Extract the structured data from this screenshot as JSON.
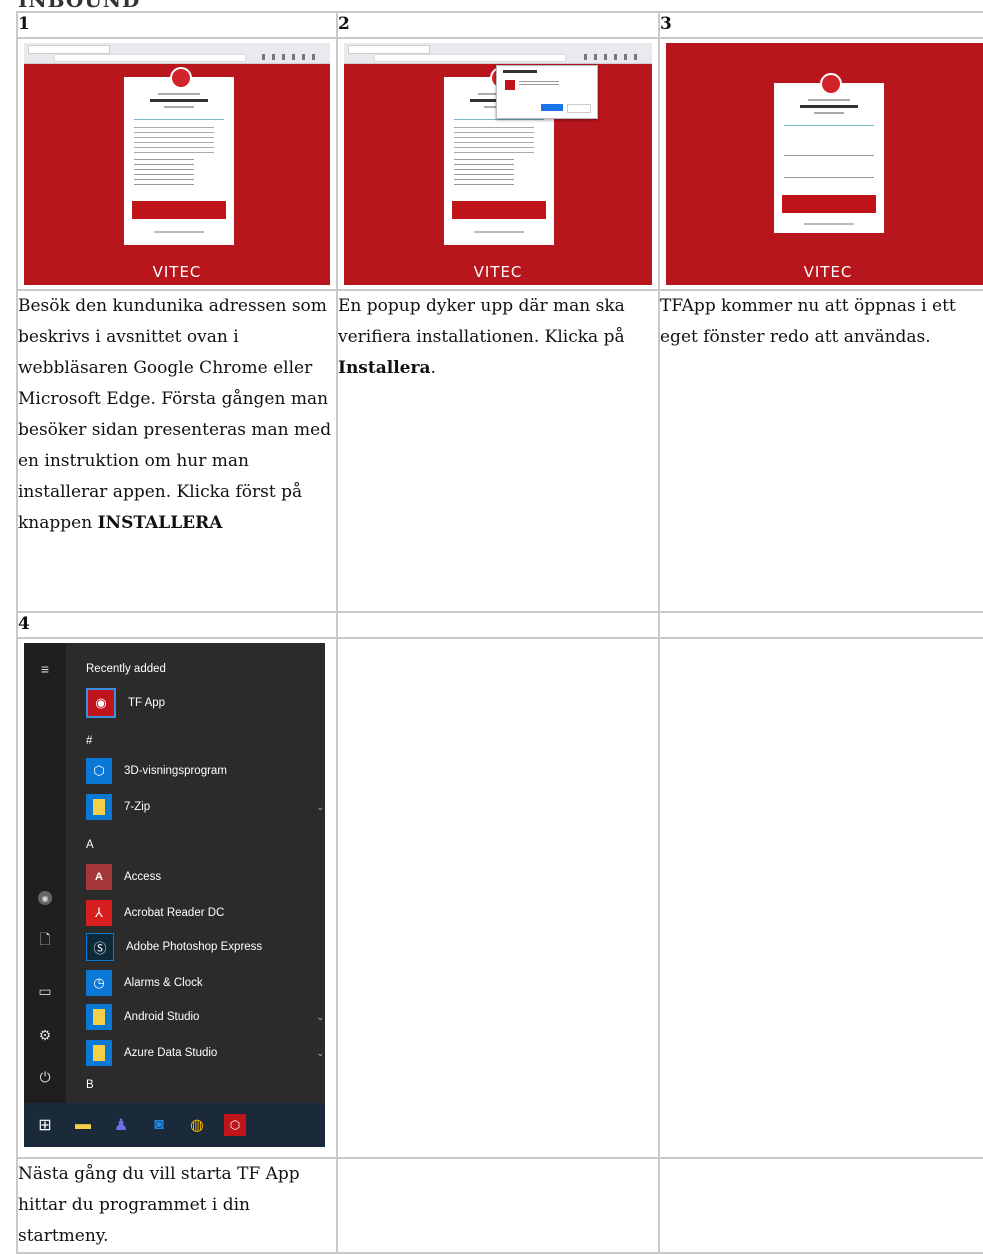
{
  "page": {
    "heading": "INBOUND"
  },
  "steps": [
    {
      "number": "1",
      "text_plain": "Besök den kundunika adressen som beskrivs i avsnittet ovan i webbläsaren Google Chrome eller Microsoft Edge. Första gången man besöker sidan presenteras man med en instruktion om hur man installerar appen. Klicka först på knappen ",
      "text_bold": "INSTALLERA",
      "text_after": ""
    },
    {
      "number": "2",
      "text_plain": "En popup dyker upp där man ska verifiera installationen. Klicka på ",
      "text_bold": "Installera",
      "text_after": "."
    },
    {
      "number": "3",
      "text_plain": "TFApp kommer nu att öppnas i ett eget fönster redo att användas.",
      "text_bold": "",
      "text_after": ""
    },
    {
      "number": "4",
      "text_plain": "Nästa gång du vill starta TF App hittar du programmet i din startmeny.",
      "text_bold": "",
      "text_after": ""
    }
  ],
  "thumbs": {
    "brand": "VITEC",
    "brand_color": "#b8161c"
  },
  "start_menu": {
    "recent_header": "Recently added",
    "sections": [
      {
        "header": "#"
      },
      {
        "header": "A"
      },
      {
        "header": "B"
      }
    ],
    "apps": [
      {
        "name": "TF App",
        "icon": "tf-app-icon",
        "color": "#c0141b"
      },
      {
        "name": "3D-visningsprogram",
        "icon": "cube-icon",
        "color": "#0a78d4"
      },
      {
        "name": "7-Zip",
        "icon": "folder-icon",
        "color": "#0a78d4"
      },
      {
        "name": "Access",
        "icon": "access-icon",
        "color": "#a4373a"
      },
      {
        "name": "Acrobat Reader DC",
        "icon": "acrobat-icon",
        "color": "#d81e1e"
      },
      {
        "name": "Adobe Photoshop Express",
        "icon": "photoshop-icon",
        "color": "#0d2a38"
      },
      {
        "name": "Alarms & Clock",
        "icon": "clock-icon",
        "color": "#0a78d4"
      },
      {
        "name": "Android Studio",
        "icon": "folder-icon",
        "color": "#0a78d4"
      },
      {
        "name": "Azure Data Studio",
        "icon": "folder-icon",
        "color": "#0a78d4"
      }
    ]
  }
}
